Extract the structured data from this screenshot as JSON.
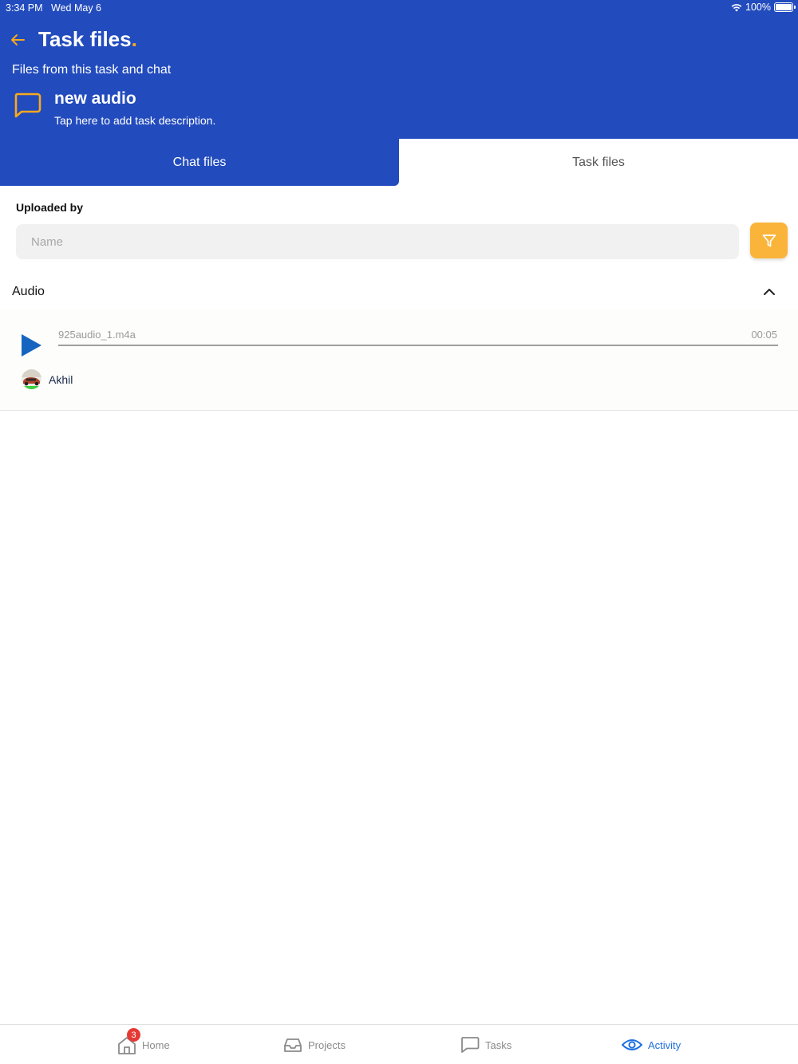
{
  "status_bar": {
    "time": "3:34 PM",
    "date": "Wed May 6",
    "battery": "100%"
  },
  "header": {
    "title": "Task files",
    "title_dot": ".",
    "subtitle": "Files from this task and chat",
    "task_name": "new audio",
    "task_description": "Tap here to add task description."
  },
  "tabs": [
    {
      "label": "Chat files",
      "active": true
    },
    {
      "label": "Task files",
      "active": false
    }
  ],
  "filter": {
    "label": "Uploaded by",
    "placeholder": "Name",
    "value": ""
  },
  "section": {
    "title": "Audio"
  },
  "audio_item": {
    "file_name": "925audio_1.m4a",
    "duration": "00:05",
    "progress": 0,
    "uploader": "Akhil"
  },
  "bottom_nav": {
    "items": [
      {
        "label": "Home",
        "icon": "home-icon",
        "badge": "3"
      },
      {
        "label": "Projects",
        "icon": "inbox-icon"
      },
      {
        "label": "Tasks",
        "icon": "chat-bubble-icon"
      },
      {
        "label": "Activity",
        "icon": "eye-icon",
        "active": true
      }
    ]
  },
  "colors": {
    "primary": "#224bbd",
    "accent": "#f8a91c",
    "active_nav": "#1f6fe0",
    "play": "#1565c0"
  }
}
